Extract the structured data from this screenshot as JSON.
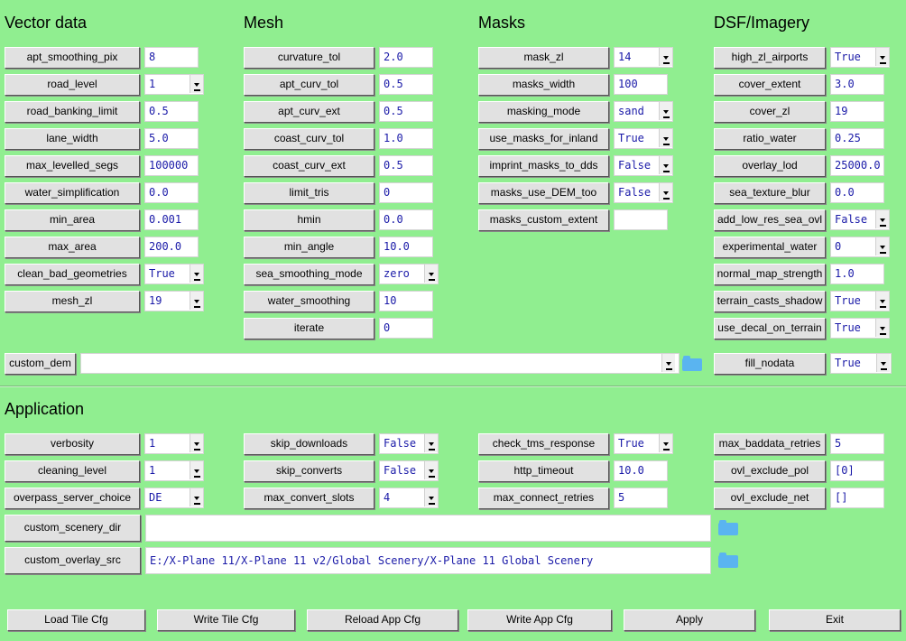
{
  "headings": {
    "vector": "Vector data",
    "mesh": "Mesh",
    "masks": "Masks",
    "dsf": "DSF/Imagery",
    "application": "Application"
  },
  "vector": [
    {
      "label": "apt_smoothing_pix",
      "value": "8",
      "combo": false
    },
    {
      "label": "road_level",
      "value": "1",
      "combo": true
    },
    {
      "label": "road_banking_limit",
      "value": "0.5",
      "combo": false
    },
    {
      "label": "lane_width",
      "value": "5.0",
      "combo": false
    },
    {
      "label": "max_levelled_segs",
      "value": "100000",
      "combo": false
    },
    {
      "label": "water_simplification",
      "value": "0.0",
      "combo": false
    },
    {
      "label": "min_area",
      "value": "0.001",
      "combo": false
    },
    {
      "label": "max_area",
      "value": "200.0",
      "combo": false
    },
    {
      "label": "clean_bad_geometries",
      "value": "True",
      "combo": true
    },
    {
      "label": "mesh_zl",
      "value": "19",
      "combo": true
    }
  ],
  "mesh": [
    {
      "label": "curvature_tol",
      "value": "2.0",
      "combo": false
    },
    {
      "label": "apt_curv_tol",
      "value": "0.5",
      "combo": false
    },
    {
      "label": "apt_curv_ext",
      "value": "0.5",
      "combo": false
    },
    {
      "label": "coast_curv_tol",
      "value": "1.0",
      "combo": false
    },
    {
      "label": "coast_curv_ext",
      "value": "0.5",
      "combo": false
    },
    {
      "label": "limit_tris",
      "value": "0",
      "combo": false
    },
    {
      "label": "hmin",
      "value": "0.0",
      "combo": false
    },
    {
      "label": "min_angle",
      "value": "10.0",
      "combo": false
    },
    {
      "label": "sea_smoothing_mode",
      "value": "zero",
      "combo": true
    },
    {
      "label": "water_smoothing",
      "value": "10",
      "combo": false
    },
    {
      "label": "iterate",
      "value": "0",
      "combo": false
    }
  ],
  "masks": [
    {
      "label": "mask_zl",
      "value": "14",
      "combo": true
    },
    {
      "label": "masks_width",
      "value": "100",
      "combo": false
    },
    {
      "label": "masking_mode",
      "value": "sand",
      "combo": true
    },
    {
      "label": "use_masks_for_inland",
      "value": "True",
      "combo": true
    },
    {
      "label": "imprint_masks_to_dds",
      "value": "False",
      "combo": true
    },
    {
      "label": "masks_use_DEM_too",
      "value": "False",
      "combo": true
    },
    {
      "label": "masks_custom_extent",
      "value": "",
      "combo": false
    }
  ],
  "dsf": [
    {
      "label": "high_zl_airports",
      "value": "True",
      "combo": true
    },
    {
      "label": "cover_extent",
      "value": "3.0",
      "combo": false
    },
    {
      "label": "cover_zl",
      "value": "19",
      "combo": false
    },
    {
      "label": "ratio_water",
      "value": "0.25",
      "combo": false
    },
    {
      "label": "overlay_lod",
      "value": "25000.0",
      "combo": false
    },
    {
      "label": "sea_texture_blur",
      "value": "0.0",
      "combo": false
    },
    {
      "label": "add_low_res_sea_ovl",
      "value": "False",
      "combo": true
    },
    {
      "label": "experimental_water",
      "value": "0",
      "combo": true
    },
    {
      "label": "normal_map_strength",
      "value": "1.0",
      "combo": false
    },
    {
      "label": "terrain_casts_shadow",
      "value": "True",
      "combo": true
    },
    {
      "label": "use_decal_on_terrain",
      "value": "True",
      "combo": true
    }
  ],
  "custom_dem": {
    "label": "custom_dem",
    "value": ""
  },
  "fill_nodata": {
    "label": "fill_nodata",
    "value": "True"
  },
  "app_col1": [
    {
      "label": "verbosity",
      "value": "1",
      "combo": true
    },
    {
      "label": "cleaning_level",
      "value": "1",
      "combo": true
    },
    {
      "label": "overpass_server_choice",
      "value": "DE",
      "combo": true
    }
  ],
  "app_col2": [
    {
      "label": "skip_downloads",
      "value": "False",
      "combo": true
    },
    {
      "label": "skip_converts",
      "value": "False",
      "combo": true
    },
    {
      "label": "max_convert_slots",
      "value": "4",
      "combo": true
    }
  ],
  "app_col3": [
    {
      "label": "check_tms_response",
      "value": "True",
      "combo": true
    },
    {
      "label": "http_timeout",
      "value": "10.0",
      "combo": false
    },
    {
      "label": "max_connect_retries",
      "value": "5",
      "combo": false
    }
  ],
  "app_col4": [
    {
      "label": "max_baddata_retries",
      "value": "5",
      "combo": false
    },
    {
      "label": "ovl_exclude_pol",
      "value": "[0]",
      "combo": false
    },
    {
      "label": "ovl_exclude_net",
      "value": "[]",
      "combo": false
    }
  ],
  "custom_scenery_dir": {
    "label": "custom_scenery_dir",
    "value": ""
  },
  "custom_overlay_src": {
    "label": "custom_overlay_src",
    "value": "E:/X-Plane 11/X-Plane 11 v2/Global Scenery/X-Plane 11 Global Scenery"
  },
  "buttons": {
    "load_tile": "Load Tile Cfg",
    "write_tile": "Write Tile Cfg",
    "reload_app": "Reload App Cfg",
    "write_app": "Write App Cfg",
    "apply": "Apply",
    "exit": "Exit"
  }
}
